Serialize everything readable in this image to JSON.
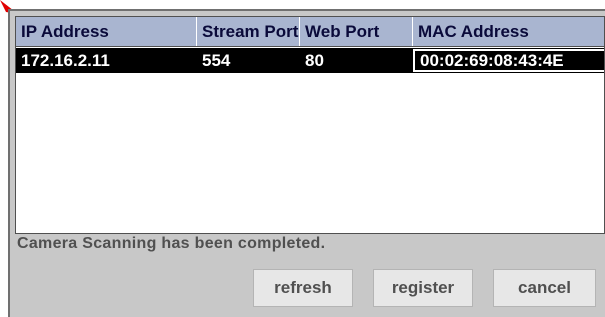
{
  "table": {
    "columns": [
      "IP Address",
      "Stream Port",
      "Web Port",
      "MAC Address"
    ],
    "rows": [
      [
        "172.16.2.11",
        "554",
        "80",
        "00:02:69:08:43:4E"
      ]
    ]
  },
  "status_text": "Camera Scanning has been completed.",
  "buttons": {
    "refresh": "refresh",
    "register": "register",
    "cancel": "cancel"
  },
  "colors": {
    "header_bg": "#a9b5d0",
    "selected_row_bg": "#000000",
    "dialog_bg": "#c8c8c8",
    "cursor": "#e00000"
  }
}
